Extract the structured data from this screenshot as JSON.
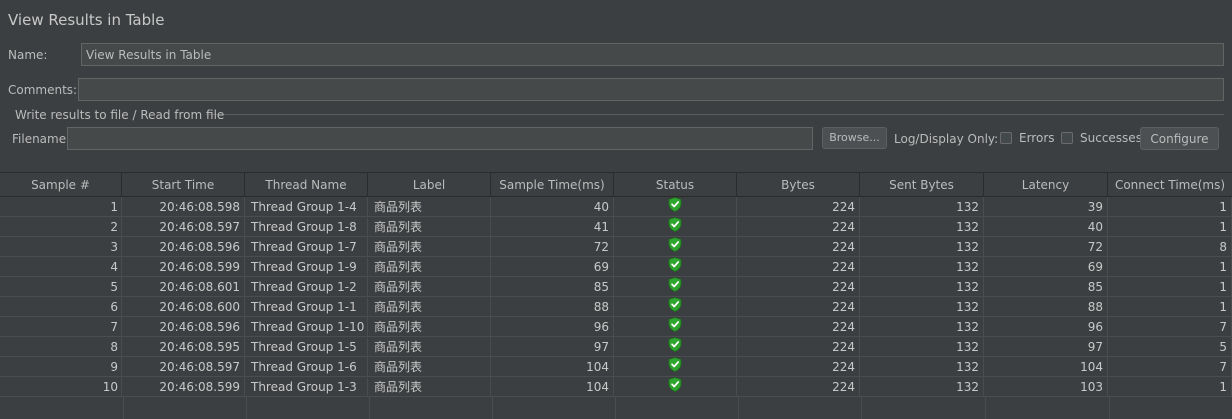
{
  "panel": {
    "title": "View Results in Table"
  },
  "form": {
    "name_label": "Name:",
    "name_value": "View Results in Table",
    "comments_label": "Comments:",
    "comments_value": "",
    "file_group_title": "Write results to file / Read from file",
    "filename_label": "Filename",
    "filename_value": "",
    "browse_label": "Browse...",
    "log_display_label": "Log/Display Only:",
    "errors_label": "Errors",
    "successes_label": "Successes",
    "configure_label": "Configure"
  },
  "table": {
    "columns": [
      "Sample #",
      "Start Time",
      "Thread Name",
      "Label",
      "Sample Time(ms)",
      "Status",
      "Bytes",
      "Sent Bytes",
      "Latency",
      "Connect Time(ms)"
    ],
    "rows": [
      {
        "sample": "1",
        "start": "20:46:08.598",
        "thread": "Thread Group 1-4",
        "label": "商品列表",
        "time": "40",
        "status": "success",
        "bytes": "224",
        "sent": "132",
        "latency": "39",
        "connect": "1"
      },
      {
        "sample": "2",
        "start": "20:46:08.597",
        "thread": "Thread Group 1-8",
        "label": "商品列表",
        "time": "41",
        "status": "success",
        "bytes": "224",
        "sent": "132",
        "latency": "40",
        "connect": "1"
      },
      {
        "sample": "3",
        "start": "20:46:08.596",
        "thread": "Thread Group 1-7",
        "label": "商品列表",
        "time": "72",
        "status": "success",
        "bytes": "224",
        "sent": "132",
        "latency": "72",
        "connect": "8"
      },
      {
        "sample": "4",
        "start": "20:46:08.599",
        "thread": "Thread Group 1-9",
        "label": "商品列表",
        "time": "69",
        "status": "success",
        "bytes": "224",
        "sent": "132",
        "latency": "69",
        "connect": "1"
      },
      {
        "sample": "5",
        "start": "20:46:08.601",
        "thread": "Thread Group 1-2",
        "label": "商品列表",
        "time": "85",
        "status": "success",
        "bytes": "224",
        "sent": "132",
        "latency": "85",
        "connect": "1"
      },
      {
        "sample": "6",
        "start": "20:46:08.600",
        "thread": "Thread Group 1-1",
        "label": "商品列表",
        "time": "88",
        "status": "success",
        "bytes": "224",
        "sent": "132",
        "latency": "88",
        "connect": "1"
      },
      {
        "sample": "7",
        "start": "20:46:08.596",
        "thread": "Thread Group 1-10",
        "label": "商品列表",
        "time": "96",
        "status": "success",
        "bytes": "224",
        "sent": "132",
        "latency": "96",
        "connect": "7"
      },
      {
        "sample": "8",
        "start": "20:46:08.595",
        "thread": "Thread Group 1-5",
        "label": "商品列表",
        "time": "97",
        "status": "success",
        "bytes": "224",
        "sent": "132",
        "latency": "97",
        "connect": "5"
      },
      {
        "sample": "9",
        "start": "20:46:08.597",
        "thread": "Thread Group 1-6",
        "label": "商品列表",
        "time": "104",
        "status": "success",
        "bytes": "224",
        "sent": "132",
        "latency": "104",
        "connect": "7"
      },
      {
        "sample": "10",
        "start": "20:46:08.599",
        "thread": "Thread Group 1-3",
        "label": "商品列表",
        "time": "104",
        "status": "success",
        "bytes": "224",
        "sent": "132",
        "latency": "103",
        "connect": "1"
      }
    ]
  },
  "icons": {
    "status": "shield-check-icon"
  },
  "colors": {
    "background": "#3c3f41",
    "success_green": "#3dbb3d"
  }
}
